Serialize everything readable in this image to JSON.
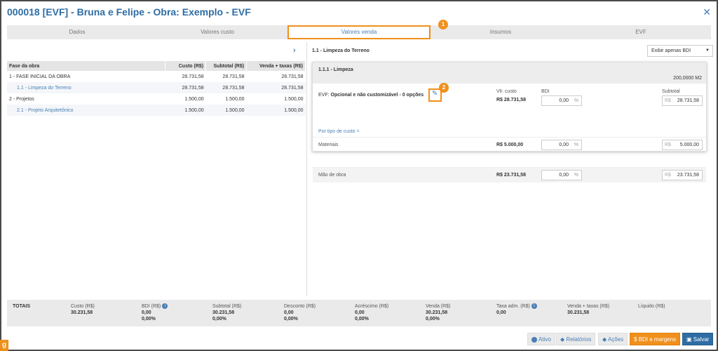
{
  "window": {
    "title": "000018 [EVF] - Bruna e Felipe - Obra: Exemplo - EVF"
  },
  "tabs": [
    {
      "label": "Dados"
    },
    {
      "label": "Valores custo"
    },
    {
      "label": "Valores venda"
    },
    {
      "label": "Insumos"
    },
    {
      "label": "EVF"
    }
  ],
  "badges": {
    "one": "1",
    "two": "2"
  },
  "left_table": {
    "headers": [
      "Fase da obra",
      "Custo (R$)",
      "Subtotal (R$)",
      "Venda + taxas (R$)"
    ],
    "rows": [
      {
        "label": "1 - FASE INICIAL DA OBRA",
        "custo": "28.731,58",
        "subtotal": "28.731,58",
        "venda": "28.731,58"
      },
      {
        "label": "1.1 - Limpeza do Terreno",
        "custo": "28.731,58",
        "subtotal": "28.731,58",
        "venda": "28.731,58"
      },
      {
        "label": "2 - Projetos",
        "custo": "1.500,00",
        "subtotal": "1.500,00",
        "venda": "1.500,00"
      },
      {
        "label": "2.1 - Projeto Arquitetônico",
        "custo": "1.500,00",
        "subtotal": "1.500,00",
        "venda": "1.500,00"
      }
    ]
  },
  "right": {
    "title": "1.1 - Limpeza do Terreno",
    "select_value": "Exibir apenas BDI",
    "card": {
      "title": "1.1.1 - Limpeza",
      "quantity": "200,0000 M2",
      "evf_label": "EVF:",
      "evf_value": "Opcional e não customizável - 0 opções",
      "vlr_custo_label": "Vlr. custo",
      "vlr_custo_value": "R$ 28.731,58",
      "bdi_label": "BDI",
      "bdi_value": "0,00",
      "pct": "%",
      "subtotal_label": "Subtotal",
      "currency": "R$",
      "subtotal_value": "28.731,58",
      "por_tipo": "Por tipo de custo",
      "rows": [
        {
          "label": "Materiais",
          "custo": "R$ 5.000,00",
          "bdi": "0,00",
          "subtotal": "5.000,00"
        },
        {
          "label": "Mão de obra",
          "custo": "R$ 23.731,58",
          "bdi": "0,00",
          "subtotal": "23.731,58"
        }
      ]
    }
  },
  "totals": {
    "label": "TOTAIS",
    "columns": [
      {
        "header": "Custo (R$)",
        "value": "30.231,58",
        "pct": ""
      },
      {
        "header": "BDI (R$)",
        "value": "0,00",
        "pct": "0,00%"
      },
      {
        "header": "Subtotal (R$)",
        "value": "30.231,58",
        "pct": "0,00%"
      },
      {
        "header": "Desconto (R$)",
        "value": "0,00",
        "pct": "0,00%"
      },
      {
        "header": "Acréscimo (R$)",
        "value": "0,00",
        "pct": "0,00%"
      },
      {
        "header": "Venda (R$)",
        "value": "30.231,58",
        "pct": "0,00%"
      },
      {
        "header": "Taxa adm. (R$)",
        "value": "0,00",
        "pct": ""
      },
      {
        "header": "Venda + taxas (R$)",
        "value": "30.231,58",
        "pct": ""
      },
      {
        "header": "Líquido (R$)",
        "value": "",
        "pct": ""
      }
    ]
  },
  "footer": {
    "ativo": "Ativo",
    "relatorios": "Relatórios",
    "acoes": "Ações",
    "bdi_margens": "BDI e margens",
    "dollar": "$",
    "salvar": "Salvar"
  },
  "colors": {
    "accent": "#2e6da4",
    "highlight": "#f0901c",
    "link": "#4a7fb5"
  }
}
